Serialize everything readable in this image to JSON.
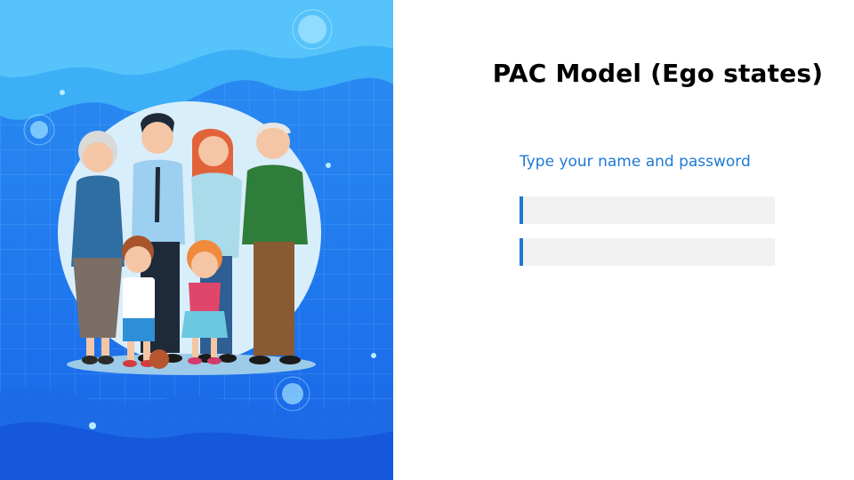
{
  "title": "PAC Model (Ego states)",
  "login": {
    "prompt": "Type your name and password",
    "name_value": "",
    "password_value": ""
  },
  "colors": {
    "accent": "#1e78d6",
    "field_background": "#f2f2f2",
    "panel_blue_dark": "#1f6ff0",
    "panel_blue_light": "#3fb2f5"
  },
  "illustration": {
    "subject": "family-group-illustration",
    "members": [
      "grandmother",
      "father",
      "mother",
      "grandfather",
      "boy",
      "girl"
    ]
  }
}
